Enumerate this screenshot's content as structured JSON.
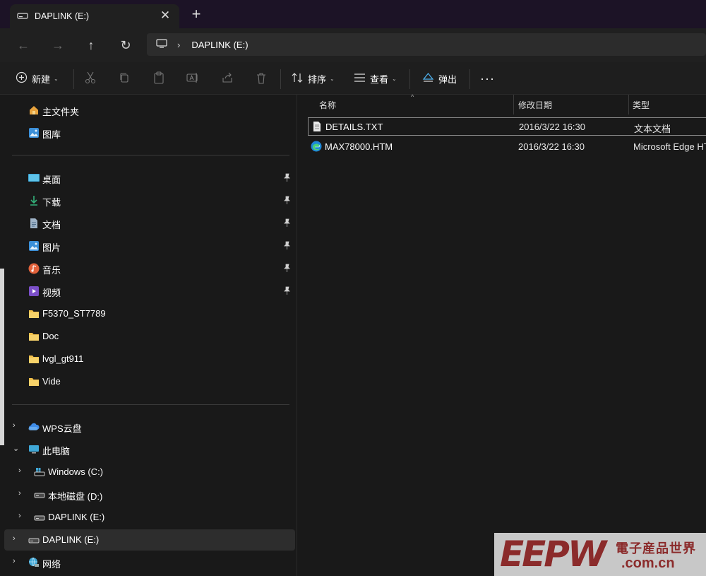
{
  "tab": {
    "title": "DAPLINK (E:)",
    "close": "✕",
    "new": "+"
  },
  "address": {
    "back": "←",
    "forward": "→",
    "up": "↑",
    "refresh": "↻",
    "separator": "›",
    "crumb": "DAPLINK (E:)"
  },
  "commands": {
    "new_label": "新建",
    "sort_label": "排序",
    "view_label": "查看",
    "eject_label": "弹出",
    "more": "···",
    "caret": "⌄"
  },
  "nav": {
    "top": [
      {
        "label": "主文件夹",
        "icon": "home-icon"
      },
      {
        "label": "图库",
        "icon": "gallery-icon"
      }
    ],
    "pinned": [
      {
        "label": "桌面",
        "icon": "desktop-icon",
        "pinned": true
      },
      {
        "label": "下载",
        "icon": "download-icon",
        "pinned": true
      },
      {
        "label": "文档",
        "icon": "document-icon",
        "pinned": true
      },
      {
        "label": "图片",
        "icon": "pictures-icon",
        "pinned": true
      },
      {
        "label": "音乐",
        "icon": "music-icon",
        "pinned": true
      },
      {
        "label": "视频",
        "icon": "video-icon",
        "pinned": true
      },
      {
        "label": "F5370_ST7789",
        "icon": "folder-icon",
        "pinned": false
      },
      {
        "label": "Doc",
        "icon": "folder-icon",
        "pinned": false
      },
      {
        "label": "lvgl_gt911",
        "icon": "folder-icon",
        "pinned": false
      },
      {
        "label": "Vide",
        "icon": "folder-icon",
        "pinned": false
      }
    ],
    "tree": [
      {
        "label": "WPS云盘",
        "icon": "cloud-icon",
        "chevron": "›"
      },
      {
        "label": "此电脑",
        "icon": "pc-icon",
        "chevron": "⌄"
      },
      {
        "label": "Windows (C:)",
        "icon": "windows-drive-icon",
        "chevron": "›"
      },
      {
        "label": "本地磁盘 (D:)",
        "icon": "drive-icon",
        "chevron": "›"
      },
      {
        "label": "DAPLINK (E:)",
        "icon": "drive-icon",
        "chevron": "›"
      },
      {
        "label": "DAPLINK (E:)",
        "icon": "drive-icon",
        "chevron": "›",
        "selected": true
      },
      {
        "label": "网络",
        "icon": "network-icon",
        "chevron": "›"
      }
    ]
  },
  "columns": {
    "name": "名称",
    "date": "修改日期",
    "type": "类型"
  },
  "files": [
    {
      "name": "DETAILS.TXT",
      "date": "2016/3/22 16:30",
      "type": "文本文档",
      "icon": "text-file-icon"
    },
    {
      "name": "MAX78000.HTM",
      "date": "2016/3/22 16:30",
      "type": "Microsoft Edge HT",
      "icon": "edge-icon"
    }
  ],
  "watermark": {
    "logo": "EEPW",
    "cn": "電子産品世界",
    "domain": ".com.cn"
  },
  "colors": {
    "accent_titlebar": "#1c1326",
    "folder": "#f2c04a",
    "watermark": "#8b2b2b"
  }
}
